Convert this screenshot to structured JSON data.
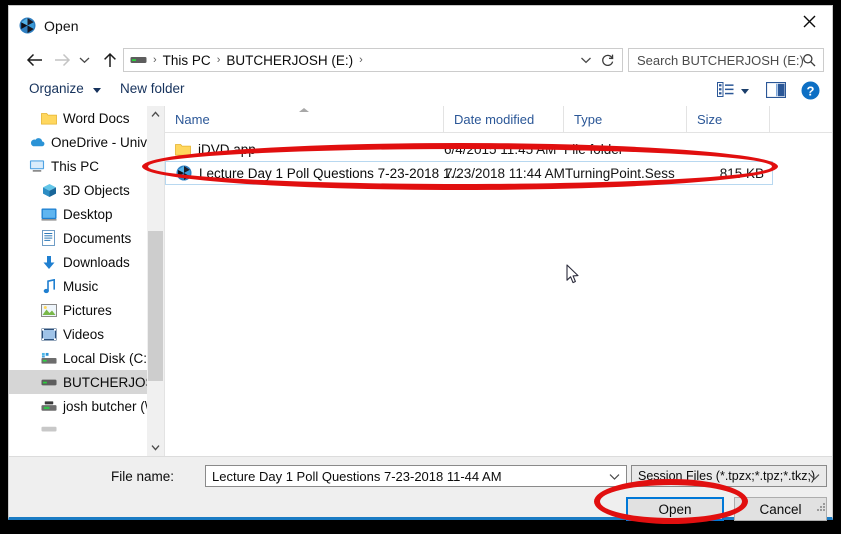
{
  "window": {
    "title": "Open",
    "title_icon": "turningpoint-icon",
    "close_label": "✕"
  },
  "navigation": {
    "back_icon": "arrow-left-icon",
    "forward_icon": "arrow-right-icon",
    "recent_icon": "chevron-down-icon",
    "up_icon": "arrow-up-icon",
    "address": {
      "drive_icon": "drive-icon",
      "crumbs": [
        "This PC",
        "BUTCHERJOSH (E:)"
      ],
      "separator": "›",
      "dropdown_icon": "chevron-down-icon",
      "refresh_icon": "refresh-icon"
    },
    "search": {
      "placeholder": "Search BUTCHERJOSH (E:)",
      "icon": "search-icon"
    }
  },
  "toolbar": {
    "organize_label": "Organize",
    "organize_caret": "chevron-down-icon",
    "new_folder_label": "New folder",
    "view_icon": "view-options-icon",
    "view_caret": "chevron-down-icon",
    "preview_pane_icon": "preview-pane-icon",
    "help_icon": "help-icon"
  },
  "nav_pane": {
    "scroll_up_icon": "chevron-up-icon",
    "scroll_down_icon": "chevron-down-icon",
    "items": [
      {
        "label": "Word Docs",
        "icon": "folder-icon",
        "indent": 1,
        "selected": false
      },
      {
        "label": "OneDrive - Univer",
        "icon": "onedrive-icon",
        "indent": 0,
        "selected": false
      },
      {
        "label": "This PC",
        "icon": "thispc-icon",
        "indent": 0,
        "selected": false
      },
      {
        "label": "3D Objects",
        "icon": "3dobjects-icon",
        "indent": 1,
        "selected": false
      },
      {
        "label": "Desktop",
        "icon": "desktop-icon",
        "indent": 1,
        "selected": false
      },
      {
        "label": "Documents",
        "icon": "documents-icon",
        "indent": 1,
        "selected": false
      },
      {
        "label": "Downloads",
        "icon": "downloads-icon",
        "indent": 1,
        "selected": false
      },
      {
        "label": "Music",
        "icon": "music-icon",
        "indent": 1,
        "selected": false
      },
      {
        "label": "Pictures",
        "icon": "pictures-icon",
        "indent": 1,
        "selected": false
      },
      {
        "label": "Videos",
        "icon": "videos-icon",
        "indent": 1,
        "selected": false
      },
      {
        "label": "Local Disk (C:)",
        "icon": "harddisk-icon",
        "indent": 1,
        "selected": false
      },
      {
        "label": "BUTCHERJOSH (",
        "icon": "usbdrive-icon",
        "indent": 1,
        "selected": true
      },
      {
        "label": "josh butcher (\\\\f",
        "icon": "network-icon",
        "indent": 1,
        "selected": false
      }
    ]
  },
  "file_list": {
    "columns": [
      {
        "label": "Name",
        "sorted": true
      },
      {
        "label": "Date modified",
        "sorted": false
      },
      {
        "label": "Type",
        "sorted": false
      },
      {
        "label": "Size",
        "sorted": false
      }
    ],
    "rows": [
      {
        "icon": "folder-icon",
        "name": "iDVD app",
        "date": "6/4/2015 11:45 AM",
        "type": "File folder",
        "size": "",
        "selected": false
      },
      {
        "icon": "turningpoint-icon",
        "name": "Lecture Day 1 Poll Questions 7-23-2018 1...",
        "date": "7/23/2018 11:44 AM",
        "type": "TurningPoint.Sess",
        "size": "815 KB",
        "selected": true
      }
    ]
  },
  "footer": {
    "file_name_label": "File name:",
    "file_name_value": "Lecture Day 1 Poll Questions 7-23-2018 11-44 AM",
    "file_name_chevron": "chevron-down-icon",
    "file_type_value": "Session Files (*.tpzx;*.tpz;*.tkz;)",
    "file_type_chevron": "chevron-down-icon",
    "open_label": "Open",
    "cancel_label": "Cancel",
    "resize_grip_icon": "resize-grip-icon"
  },
  "annotations": {
    "color": "#e10f0f",
    "shapes": [
      {
        "name": "ellipse-around-selected-file"
      },
      {
        "name": "ellipse-around-open-button"
      }
    ]
  },
  "cursor": {
    "icon": "mouse-pointer-icon"
  }
}
